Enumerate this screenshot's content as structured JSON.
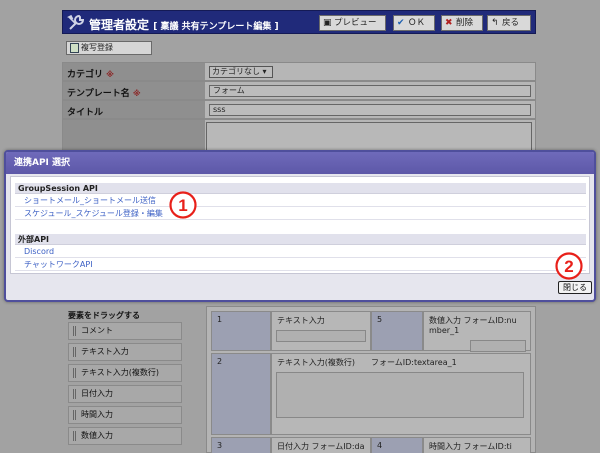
{
  "title_bar": {
    "title": "管理者設定",
    "subtitle": "[ 稟議 共有テンプレート編集 ]",
    "buttons": {
      "preview": "プレビュー",
      "ok": "ＯＫ",
      "delete": "削除",
      "back": "戻る"
    }
  },
  "toolbar": {
    "copy_register": "複写登録"
  },
  "form": {
    "category_label": "カテゴリ",
    "category_value": "カテゴリなし",
    "template_name_label": "テンプレート名",
    "template_name_value": "フォーム",
    "title_label": "タイトル",
    "title_value": "sss",
    "required_mark": "※"
  },
  "palette": {
    "heading": "要素をドラッグする",
    "items": [
      "コメント",
      "テキスト入力",
      "テキスト入力(複数行)",
      "日付入力",
      "時間入力",
      "数値入力"
    ]
  },
  "grid": {
    "cells": [
      {
        "num": "1",
        "label": "テキスト入力"
      },
      {
        "num": "5",
        "label": "数値入力 フォームID:nu",
        "label2": "mber_1"
      },
      {
        "num": "2",
        "label": "テキスト入力(複数行)　　フォームID:textarea_1"
      },
      {
        "num": "3",
        "label": "日付入力 フォームID:da"
      },
      {
        "num": "4",
        "label": "時間入力 フォームID:ti"
      }
    ]
  },
  "modal": {
    "title": "連携API 選択",
    "groups": [
      {
        "header": "GroupSession API",
        "links": [
          "ショートメール_ショートメール送信",
          "スケジュール_スケジュール登録・編集"
        ]
      },
      {
        "header": "外部API",
        "links": [
          "Discord",
          "チャットワークAPI"
        ]
      }
    ],
    "close_label": "閉じる"
  },
  "annotations": {
    "one": "1",
    "two": "2"
  },
  "colors": {
    "title_bar": "#202a7a",
    "modal_header": "#645fae",
    "link": "#3b5fc4",
    "annotation": "#e8201a"
  }
}
